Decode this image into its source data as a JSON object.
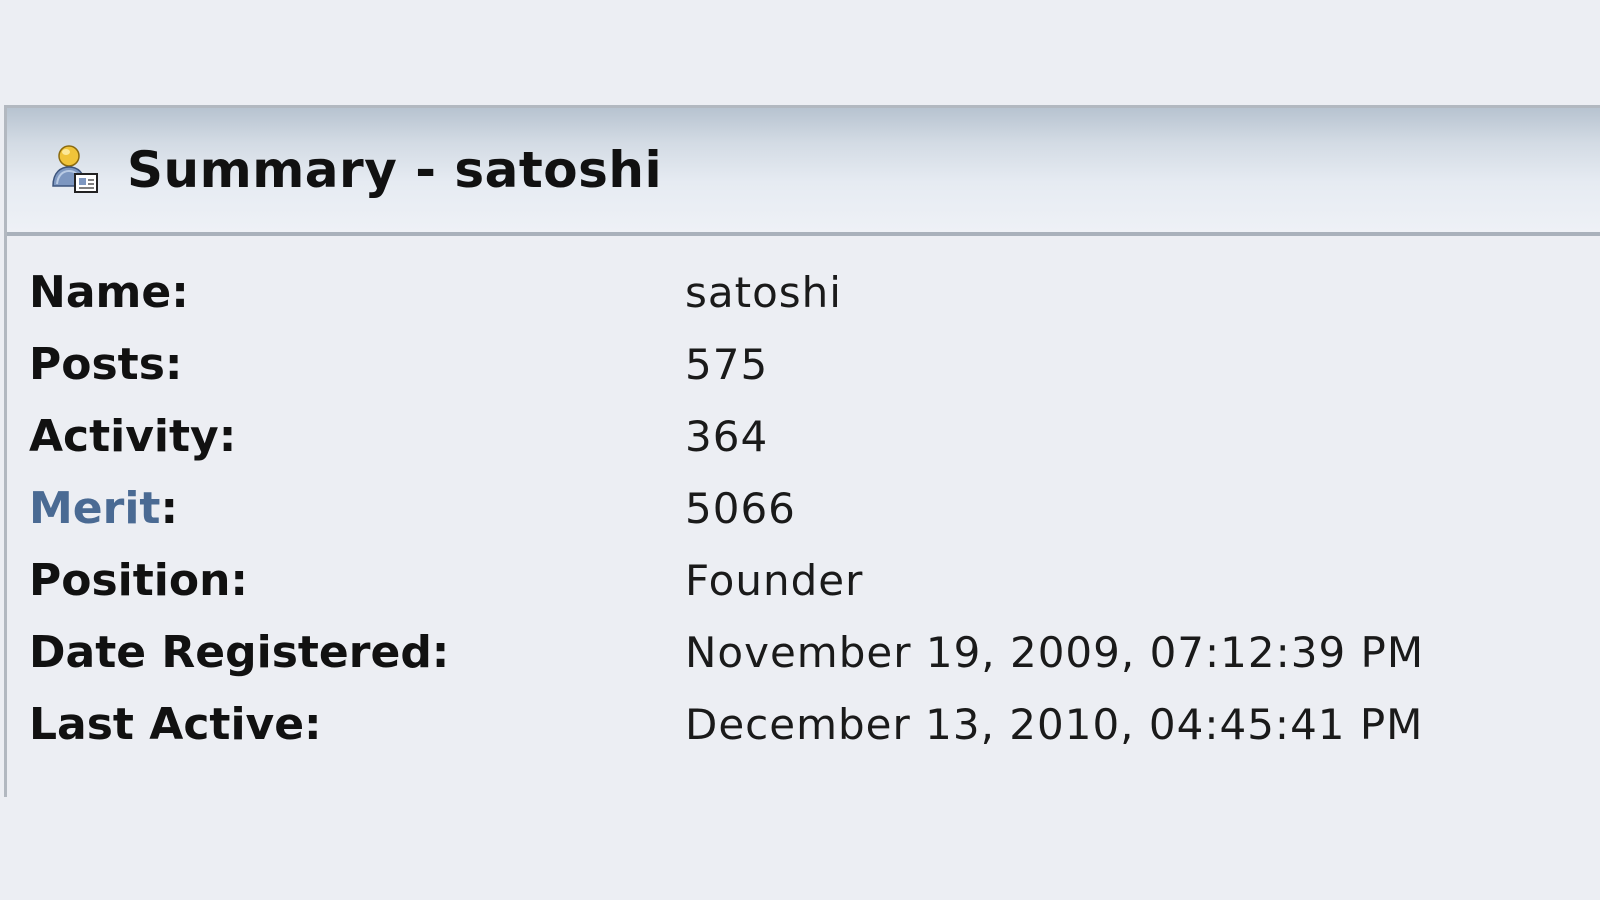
{
  "header": {
    "icon": "user-profile-icon",
    "title": "Summary - satoshi"
  },
  "summary": {
    "rows": [
      {
        "label": "Name:",
        "value": "satoshi"
      },
      {
        "label": "Posts:",
        "value": "575"
      },
      {
        "label": "Activity:",
        "value": "364"
      },
      {
        "label_link": "Merit",
        "label_suffix": ":",
        "value": "5066"
      },
      {
        "label": "Position:",
        "value": "Founder"
      },
      {
        "label": "Date Registered:",
        "value": "November 19, 2009, 07:12:39 PM"
      },
      {
        "label": "Last Active:",
        "value": "December 13, 2010, 04:45:41 PM"
      }
    ]
  },
  "colors": {
    "background": "#eceef3",
    "merit_link": "#4a6a93",
    "header_gradient_top": "#b7c3d0",
    "border": "#b2b8c0"
  }
}
